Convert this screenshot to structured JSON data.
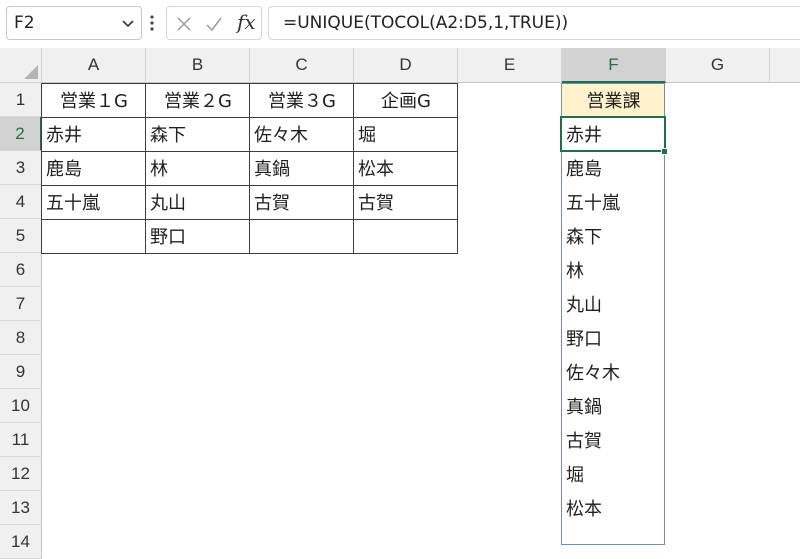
{
  "formula_bar": {
    "name_box": "F2",
    "fx_label": "fx",
    "formula": "=UNIQUE(TOCOL(A2:D5,1,TRUE))"
  },
  "columns": [
    "A",
    "B",
    "C",
    "D",
    "E",
    "F",
    "G"
  ],
  "selected_column": "F",
  "rows": [
    "1",
    "2",
    "3",
    "4",
    "5",
    "6",
    "7",
    "8",
    "9",
    "10",
    "11",
    "12",
    "13",
    "14"
  ],
  "selected_row": "2",
  "table": {
    "headers": [
      "営業１G",
      "営業２G",
      "営業３G",
      "企画G"
    ],
    "body": [
      [
        "赤井",
        "森下",
        "佐々木",
        "堀"
      ],
      [
        "鹿島",
        "林",
        "真鍋",
        "松本"
      ],
      [
        "五十嵐",
        "丸山",
        "古賀",
        "古賀"
      ],
      [
        "",
        "野口",
        "",
        ""
      ]
    ]
  },
  "result": {
    "header": "営業課",
    "values": [
      "赤井",
      "鹿島",
      "五十嵐",
      "森下",
      "林",
      "丸山",
      "野口",
      "佐々木",
      "真鍋",
      "古賀",
      "堀",
      "松本"
    ]
  },
  "colors": {
    "accent_green": "#1e7145",
    "header_fill": "#fff2cc",
    "spill_border": "#6c8ebf"
  }
}
